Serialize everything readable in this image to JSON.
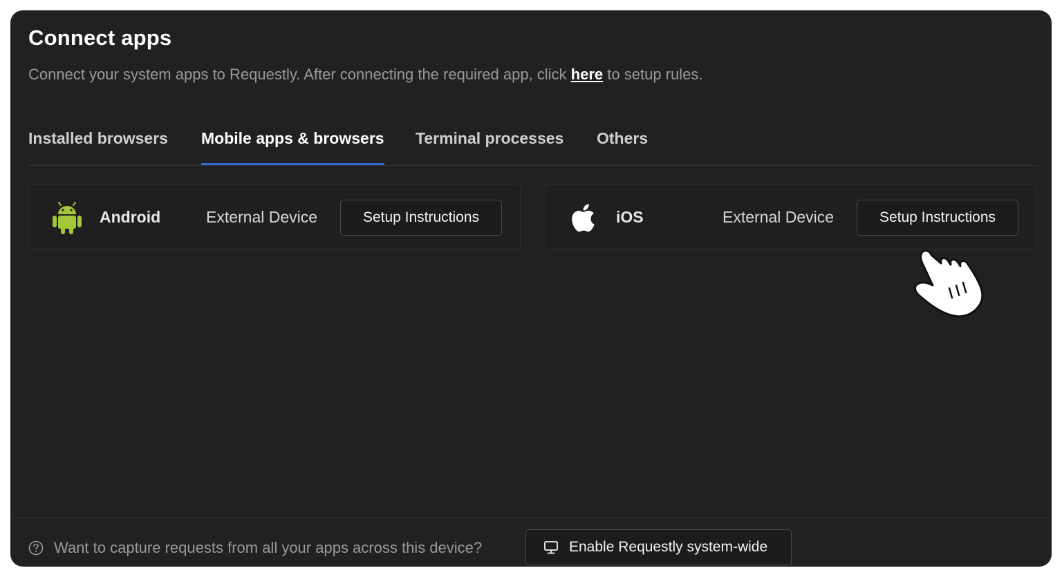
{
  "header": {
    "title": "Connect apps",
    "subtitle_before": "Connect your system apps to Requestly. After connecting the required app, click ",
    "subtitle_link": "here",
    "subtitle_after": " to setup rules."
  },
  "tabs": [
    {
      "label": "Installed browsers",
      "active": false
    },
    {
      "label": "Mobile apps & browsers",
      "active": true
    },
    {
      "label": "Terminal processes",
      "active": false
    },
    {
      "label": "Others",
      "active": false
    }
  ],
  "devices": [
    {
      "name": "Android",
      "type": "External Device",
      "button": "Setup Instructions",
      "icon": "android-icon",
      "icon_color": "#a4c639"
    },
    {
      "name": "iOS",
      "type": "External Device",
      "button": "Setup Instructions",
      "icon": "apple-icon",
      "icon_color": "#ffffff"
    }
  ],
  "footer": {
    "help_text": "Want to capture requests from all your apps across this device?",
    "enable_button": "Enable Requestly system-wide"
  },
  "colors": {
    "background": "#212121",
    "active_tab_underline": "#2f6bd8",
    "muted_text": "#9a9a9a"
  }
}
